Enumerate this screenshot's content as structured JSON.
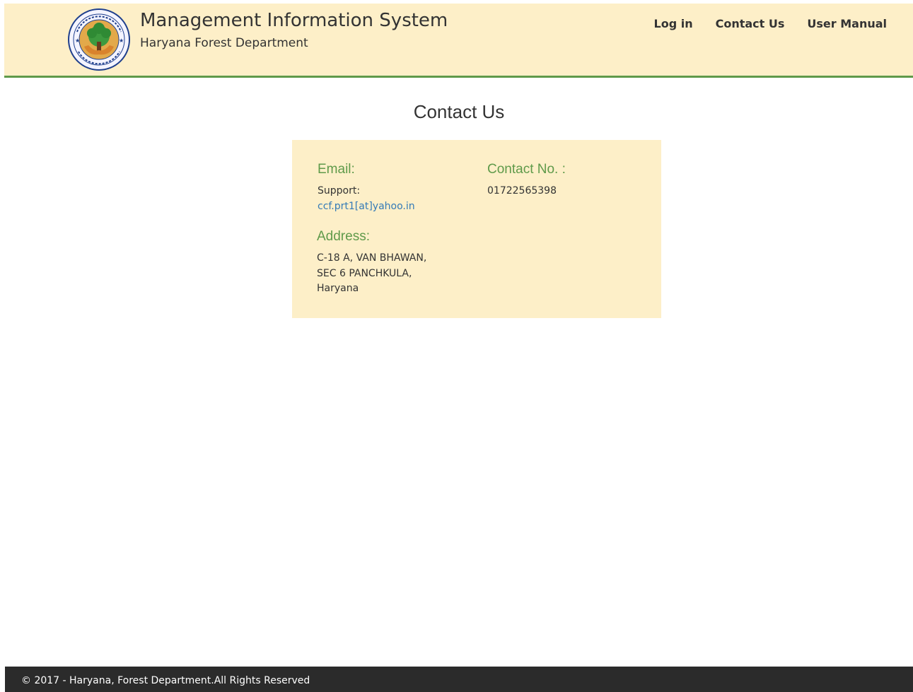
{
  "header": {
    "title": "Management Information System",
    "subtitle": "Haryana Forest Department",
    "logo_icon": "haryana-forest-emblem-icon",
    "nav": [
      {
        "label": "Log in"
      },
      {
        "label": "Contact Us"
      },
      {
        "label": "User Manual"
      }
    ]
  },
  "main": {
    "title": "Contact Us",
    "email": {
      "heading": "Email:",
      "label": "Support:",
      "address": "ccf.prt1[at]yahoo.in"
    },
    "contact": {
      "heading": "Contact No. :",
      "number": "01722565398"
    },
    "address": {
      "heading": "Address:",
      "lines": [
        "C-18 A, VAN BHAWAN,",
        "SEC 6 PANCHKULA,",
        "Haryana"
      ]
    }
  },
  "footer": {
    "text": "© 2017 - Haryana, Forest Department.All Rights Reserved"
  },
  "colors": {
    "header_bg": "#fdefc8",
    "accent_green": "#5f9a4a",
    "link_blue": "#337ab7",
    "footer_bg": "#2b2b2b"
  }
}
